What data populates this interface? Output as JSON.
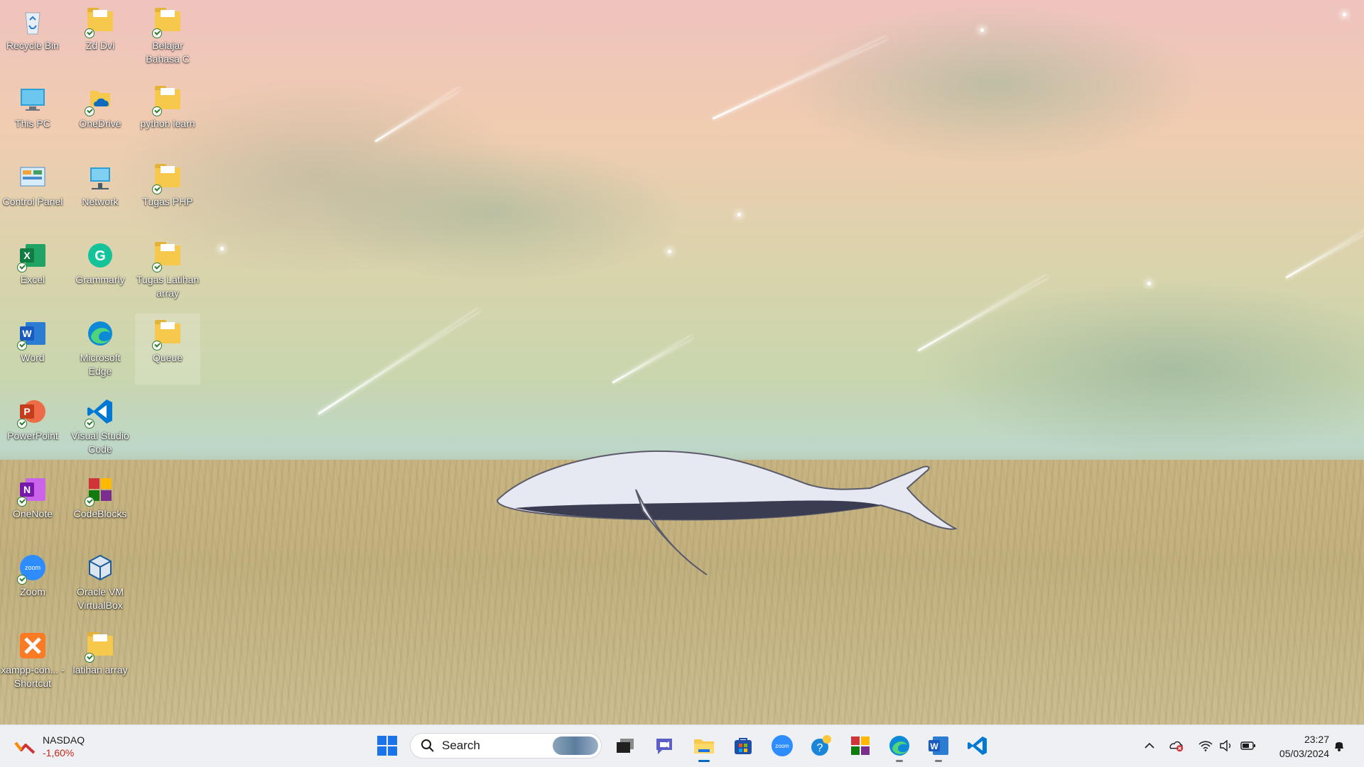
{
  "desktop_icons": [
    {
      "label": "Recycle Bin",
      "icon": "recycle-bin-icon"
    },
    {
      "label": "Zd Dvi",
      "icon": "folder-icon"
    },
    {
      "label": "Belajar Bahasa C",
      "icon": "folder-icon"
    },
    {
      "label": "This PC",
      "icon": "this-pc-icon"
    },
    {
      "label": "OneDrive",
      "icon": "onedrive-icon"
    },
    {
      "label": "python learn",
      "icon": "folder-icon"
    },
    {
      "label": "Control Panel",
      "icon": "control-panel-icon"
    },
    {
      "label": "Network",
      "icon": "network-icon"
    },
    {
      "label": "Tugas PHP",
      "icon": "folder-icon"
    },
    {
      "label": "Excel",
      "icon": "excel-icon"
    },
    {
      "label": "Grammarly",
      "icon": "grammarly-icon"
    },
    {
      "label": "Tugas Latihan array",
      "icon": "folder-icon"
    },
    {
      "label": "Word",
      "icon": "word-icon"
    },
    {
      "label": "Microsoft Edge",
      "icon": "edge-icon"
    },
    {
      "label": "Queue",
      "icon": "folder-icon"
    },
    {
      "label": "PowerPoint",
      "icon": "powerpoint-icon"
    },
    {
      "label": "Visual Studio Code",
      "icon": "vscode-icon"
    },
    {
      "label": "OneNote",
      "icon": "onenote-icon"
    },
    {
      "label": "CodeBlocks",
      "icon": "codeblocks-icon"
    },
    {
      "label": "Zoom",
      "icon": "zoom-icon"
    },
    {
      "label": "Oracle VM VirtualBox",
      "icon": "virtualbox-icon"
    },
    {
      "label": "xampp-con... - Shortcut",
      "icon": "xampp-icon"
    },
    {
      "label": "latihan array",
      "icon": "folder-icon"
    }
  ],
  "taskbar": {
    "widget": {
      "title": "NASDAQ",
      "value": "-1,60%",
      "icon": "stock-chart-icon"
    },
    "search": {
      "label": "Search"
    },
    "apps": [
      {
        "name": "Start",
        "icon": "windows-start-icon"
      },
      {
        "name": "Task View",
        "icon": "task-view-icon"
      },
      {
        "name": "Meet",
        "icon": "chat-icon"
      },
      {
        "name": "File Explorer",
        "icon": "file-explorer-icon"
      },
      {
        "name": "Microsoft Store",
        "icon": "store-icon"
      },
      {
        "name": "Zoom",
        "icon": "zoom-icon"
      },
      {
        "name": "Get Help",
        "icon": "help-icon"
      },
      {
        "name": "CodeBlocks",
        "icon": "codeblocks-icon"
      },
      {
        "name": "Microsoft Edge",
        "icon": "edge-icon"
      },
      {
        "name": "Word",
        "icon": "word-icon"
      },
      {
        "name": "Visual Studio Code",
        "icon": "vscode-icon"
      }
    ],
    "tray": {
      "icons": [
        "chevron-up-icon",
        "onedrive-error-icon",
        "wifi-icon",
        "volume-icon",
        "battery-icon",
        "notification-bell-icon"
      ],
      "time": "23:27",
      "date": "05/03/2024"
    }
  },
  "colors": {
    "taskbar_bg": "#eef0f4",
    "accent": "#0067c0",
    "widget_negative": "#c42b1c"
  }
}
